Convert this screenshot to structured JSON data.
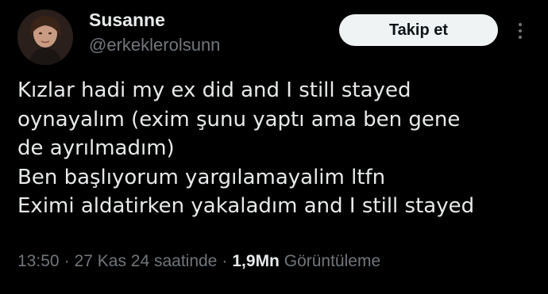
{
  "author": {
    "display_name": "Susanne",
    "handle": "@erkeklerolsunn",
    "avatar": "profile-photo"
  },
  "actions": {
    "follow_label": "Takip et",
    "more_icon": "more-vertical-icon"
  },
  "tweet": {
    "lines": [
      "Kızlar hadi my ex did and I still stayed",
      "oynayalım (exim şunu yaptı ama ben gene",
      "de ayrılmadım)",
      "Ben başlıyorum yargılamayalim ltfn",
      "Eximi aldatirken yakaladım and I still stayed"
    ]
  },
  "meta": {
    "time": "13:50",
    "separator": "·",
    "date": "27 Kas 24 saatinde",
    "views_count": "1,9Mn",
    "views_label": "Görüntüleme"
  },
  "colors": {
    "background": "#000000",
    "text_primary": "#e7e9ea",
    "text_secondary": "#71767b",
    "button_bg": "#eff3f4"
  }
}
